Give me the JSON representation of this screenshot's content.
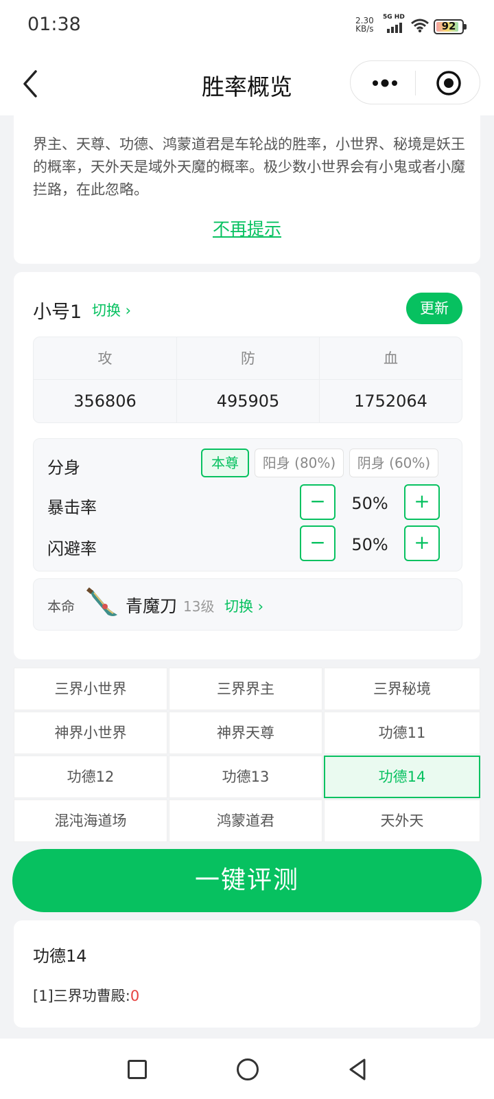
{
  "status": {
    "time": "01:38",
    "speed_value": "2.30",
    "speed_unit": "KB/s",
    "network": "5G HD",
    "battery": "92"
  },
  "nav": {
    "title": "胜率概览"
  },
  "notice": {
    "text": "界主、天尊、功德、鸿蒙道君是车轮战的胜率，小世界、秘境是妖王的概率，天外天是域外天魔的概率。极少数小世界会有小鬼或者小魔拦路，在此忽略。",
    "dismiss_link": "不再提示"
  },
  "account": {
    "name": "小号1",
    "switch_label": "切换 ›",
    "update_label": "更新",
    "stats": [
      {
        "label": "攻",
        "value": "356806"
      },
      {
        "label": "防",
        "value": "495905"
      },
      {
        "label": "血",
        "value": "1752064"
      }
    ],
    "clone": {
      "label": "分身",
      "options": [
        "本尊",
        "阳身 (80%)",
        "阴身 (60%)"
      ],
      "selected": "本尊"
    },
    "crit": {
      "label": "暴击率",
      "value": "50%",
      "minus": "−",
      "plus": "+"
    },
    "dodge": {
      "label": "闪避率",
      "value": "50%",
      "minus": "−",
      "plus": "+"
    },
    "weapon": {
      "label": "本命",
      "name": "青魔刀",
      "level": "13级",
      "switch_label": "切换 ›"
    }
  },
  "categories": {
    "items": [
      "三界小世界",
      "三界界主",
      "三界秘境",
      "神界小世界",
      "神界天尊",
      "功德11",
      "功德12",
      "功德13",
      "功德14",
      "混沌海道场",
      "鸿蒙道君",
      "天外天"
    ],
    "selected": "功德14"
  },
  "evaluate_button": "一键评测",
  "result": {
    "title": "功德14",
    "line_prefix": "[1]三界功曹殿:",
    "line_value": "0"
  },
  "colors": {
    "accent": "#07c160",
    "danger": "#e64340"
  },
  "icons": [
    "back-arrow-icon",
    "more-dots-icon",
    "target-icon",
    "signal-icon",
    "wifi-icon",
    "battery-icon",
    "saber-icon",
    "square-icon",
    "circle-icon",
    "triangle-back-icon"
  ]
}
